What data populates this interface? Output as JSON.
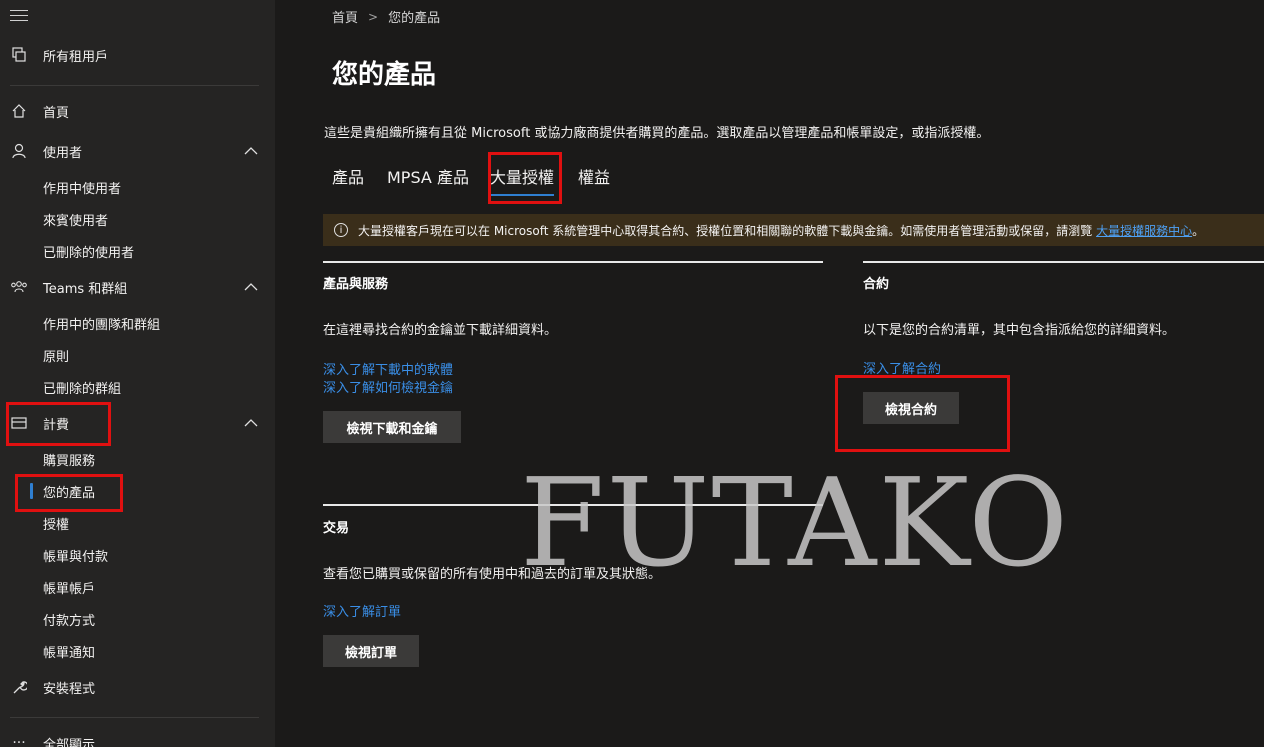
{
  "sidebar": {
    "items": [
      {
        "label": "所有租用戶",
        "icon": "tenants-icon"
      },
      {
        "label": "首頁",
        "icon": "home-icon"
      },
      {
        "label": "使用者",
        "icon": "user-icon"
      },
      {
        "label": "作用中使用者"
      },
      {
        "label": "來賓使用者"
      },
      {
        "label": "已刪除的使用者"
      },
      {
        "label": "Teams 和群組",
        "icon": "teams-groups-icon"
      },
      {
        "label": "作用中的團隊和群組"
      },
      {
        "label": "原則"
      },
      {
        "label": "已刪除的群組"
      },
      {
        "label": "計費",
        "icon": "billing-card-icon"
      },
      {
        "label": "購買服務"
      },
      {
        "label": "您的產品"
      },
      {
        "label": "授權"
      },
      {
        "label": "帳單與付款"
      },
      {
        "label": "帳單帳戶"
      },
      {
        "label": "付款方式"
      },
      {
        "label": "帳單通知"
      },
      {
        "label": "安裝程式",
        "icon": "wrench-icon"
      },
      {
        "label": "全部顯示",
        "icon": "more-icon"
      }
    ]
  },
  "breadcrumb": {
    "home": "首頁",
    "current": "您的產品"
  },
  "page": {
    "title": "您的產品",
    "description": "這些是貴組織所擁有且從 Microsoft 或協力廠商提供者購買的產品。選取產品以管理產品和帳單設定，或指派授權。"
  },
  "tabs": [
    "產品",
    "MPSA 產品",
    "大量授權",
    "權益"
  ],
  "banner": {
    "text": "大量授權客戶現在可以在 Microsoft 系統管理中心取得其合約、授權位置和相關聯的軟體下載與金鑰。如需使用者管理活動或保留，請瀏覽",
    "link": "大量授權服務中心",
    "suffix": "。"
  },
  "sections": {
    "products": {
      "title": "產品與服務",
      "text": "在這裡尋找合約的金鑰並下載詳細資料。",
      "link1": "深入了解下載中的軟體",
      "link2": "深入了解如何檢視金鑰",
      "button": "檢視下載和金鑰"
    },
    "contracts": {
      "title": "合約",
      "text": "以下是您的合約清單，其中包含指派給您的詳細資料。",
      "link": "深入了解合約",
      "button": "檢視合約"
    },
    "transactions": {
      "title": "交易",
      "text": "查看您已購買或保留的所有使用中和過去的訂單及其狀態。",
      "link": "深入了解訂單",
      "button": "檢視訂單"
    }
  },
  "watermark": "FUTAKO",
  "colors": {
    "accent": "#2f7fd1",
    "highlight": "#e01010",
    "banner_bg": "#3a2e1a"
  }
}
